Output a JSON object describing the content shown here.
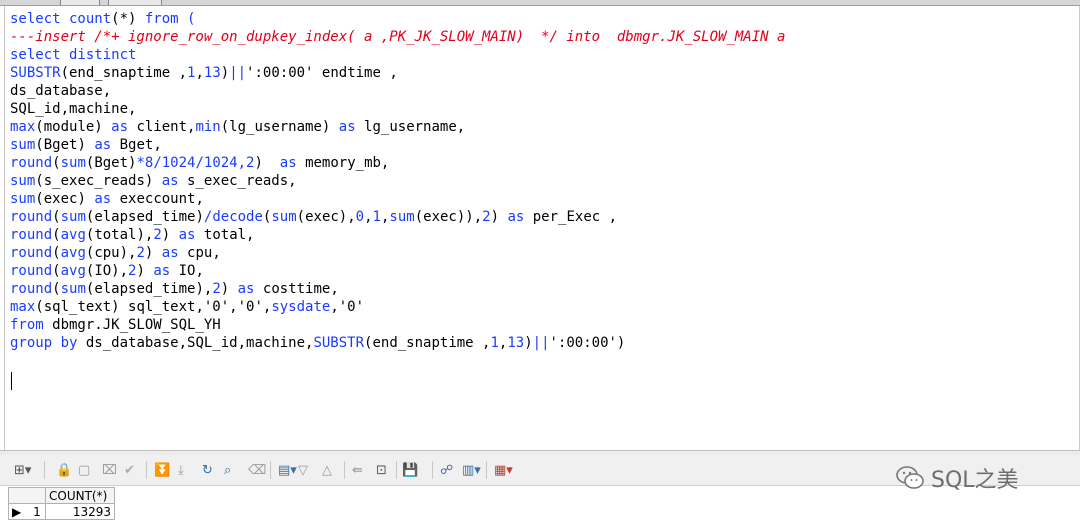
{
  "editor": {
    "lines": [
      [
        {
          "t": "select count",
          "c": "kw"
        },
        {
          "t": "(*)",
          "c": ""
        },
        {
          "t": " from (",
          "c": "kw"
        }
      ],
      [
        {
          "t": "---insert /*+ ignore_row_on_dupkey_index( a ,PK_JK_SLOW_MAIN)  */ into  dbmgr.JK_SLOW_MAIN a",
          "c": "cm"
        }
      ],
      [
        {
          "t": "select distinct",
          "c": "kw"
        }
      ],
      [
        {
          "t": "SUBSTR",
          "c": "kw"
        },
        {
          "t": "(end_snaptime ,",
          "c": ""
        },
        {
          "t": "1",
          "c": "kw"
        },
        {
          "t": ",",
          "c": ""
        },
        {
          "t": "13",
          "c": "kw"
        },
        {
          "t": ")",
          "c": ""
        },
        {
          "t": "||",
          "c": "kw"
        },
        {
          "t": "':00:00' endtime ,",
          "c": ""
        }
      ],
      [
        {
          "t": "ds_database,",
          "c": ""
        }
      ],
      [
        {
          "t": "SQL_id,machine,",
          "c": ""
        }
      ],
      [
        {
          "t": "max",
          "c": "kw"
        },
        {
          "t": "(module) ",
          "c": ""
        },
        {
          "t": "as",
          "c": "kw"
        },
        {
          "t": " client,",
          "c": ""
        },
        {
          "t": "min",
          "c": "kw"
        },
        {
          "t": "(lg_username) ",
          "c": ""
        },
        {
          "t": "as",
          "c": "kw"
        },
        {
          "t": " lg_username,",
          "c": ""
        }
      ],
      [
        {
          "t": "sum",
          "c": "kw"
        },
        {
          "t": "(Bget) ",
          "c": ""
        },
        {
          "t": "as",
          "c": "kw"
        },
        {
          "t": " Bget,",
          "c": ""
        }
      ],
      [
        {
          "t": "round",
          "c": "kw"
        },
        {
          "t": "(",
          "c": ""
        },
        {
          "t": "sum",
          "c": "kw"
        },
        {
          "t": "(Bget)",
          "c": ""
        },
        {
          "t": "*8/1024/1024,2",
          "c": "kw"
        },
        {
          "t": ")  ",
          "c": ""
        },
        {
          "t": "as",
          "c": "kw"
        },
        {
          "t": " memory_mb,",
          "c": ""
        }
      ],
      [
        {
          "t": "sum",
          "c": "kw"
        },
        {
          "t": "(s_exec_reads) ",
          "c": ""
        },
        {
          "t": "as",
          "c": "kw"
        },
        {
          "t": " s_exec_reads,",
          "c": ""
        }
      ],
      [
        {
          "t": "sum",
          "c": "kw"
        },
        {
          "t": "(exec) ",
          "c": ""
        },
        {
          "t": "as",
          "c": "kw"
        },
        {
          "t": " execcount,",
          "c": ""
        }
      ],
      [
        {
          "t": "round",
          "c": "kw"
        },
        {
          "t": "(",
          "c": ""
        },
        {
          "t": "sum",
          "c": "kw"
        },
        {
          "t": "(elapsed_time)",
          "c": ""
        },
        {
          "t": "/decode",
          "c": "kw"
        },
        {
          "t": "(",
          "c": ""
        },
        {
          "t": "sum",
          "c": "kw"
        },
        {
          "t": "(exec),",
          "c": ""
        },
        {
          "t": "0",
          "c": "kw"
        },
        {
          "t": ",",
          "c": ""
        },
        {
          "t": "1",
          "c": "kw"
        },
        {
          "t": ",",
          "c": ""
        },
        {
          "t": "sum",
          "c": "kw"
        },
        {
          "t": "(exec)),",
          "c": ""
        },
        {
          "t": "2",
          "c": "kw"
        },
        {
          "t": ") ",
          "c": ""
        },
        {
          "t": "as",
          "c": "kw"
        },
        {
          "t": " per_Exec ,",
          "c": ""
        }
      ],
      [
        {
          "t": "round",
          "c": "kw"
        },
        {
          "t": "(",
          "c": ""
        },
        {
          "t": "avg",
          "c": "kw"
        },
        {
          "t": "(total),",
          "c": ""
        },
        {
          "t": "2",
          "c": "kw"
        },
        {
          "t": ") ",
          "c": ""
        },
        {
          "t": "as",
          "c": "kw"
        },
        {
          "t": " total,",
          "c": ""
        }
      ],
      [
        {
          "t": "round",
          "c": "kw"
        },
        {
          "t": "(",
          "c": ""
        },
        {
          "t": "avg",
          "c": "kw"
        },
        {
          "t": "(cpu),",
          "c": ""
        },
        {
          "t": "2",
          "c": "kw"
        },
        {
          "t": ") ",
          "c": ""
        },
        {
          "t": "as",
          "c": "kw"
        },
        {
          "t": " cpu,",
          "c": ""
        }
      ],
      [
        {
          "t": "round",
          "c": "kw"
        },
        {
          "t": "(",
          "c": ""
        },
        {
          "t": "avg",
          "c": "kw"
        },
        {
          "t": "(IO),",
          "c": ""
        },
        {
          "t": "2",
          "c": "kw"
        },
        {
          "t": ") ",
          "c": ""
        },
        {
          "t": "as",
          "c": "kw"
        },
        {
          "t": " IO,",
          "c": ""
        }
      ],
      [
        {
          "t": "round",
          "c": "kw"
        },
        {
          "t": "(",
          "c": ""
        },
        {
          "t": "sum",
          "c": "kw"
        },
        {
          "t": "(elapsed_time),",
          "c": ""
        },
        {
          "t": "2",
          "c": "kw"
        },
        {
          "t": ") ",
          "c": ""
        },
        {
          "t": "as",
          "c": "kw"
        },
        {
          "t": " costtime,",
          "c": ""
        }
      ],
      [
        {
          "t": "max",
          "c": "kw"
        },
        {
          "t": "(sql_text) sql_text,'0','0',",
          "c": ""
        },
        {
          "t": "sysdate",
          "c": "kw"
        },
        {
          "t": ",'0'",
          "c": ""
        }
      ],
      [
        {
          "t": "from",
          "c": "kw"
        },
        {
          "t": " dbmgr.JK_SLOW_SQL_YH",
          "c": ""
        }
      ],
      [
        {
          "t": "group by",
          "c": "kw"
        },
        {
          "t": " ds_database,SQL_id,machine,",
          "c": ""
        },
        {
          "t": "SUBSTR",
          "c": "kw"
        },
        {
          "t": "(end_snaptime ,",
          "c": ""
        },
        {
          "t": "1",
          "c": "kw"
        },
        {
          "t": ",",
          "c": ""
        },
        {
          "t": "13",
          "c": "kw"
        },
        {
          "t": ")",
          "c": ""
        },
        {
          "t": "||",
          "c": "kw"
        },
        {
          "t": "':00:00')",
          "c": ""
        }
      ]
    ]
  },
  "toolbar": {
    "buttons": [
      {
        "name": "grid-options-icon",
        "glyph": "⊞▾",
        "color": "#555",
        "interact": true
      },
      {
        "name": "lock-icon",
        "glyph": "🔒",
        "color": "#c0392b",
        "interact": true
      },
      {
        "name": "insert-record-icon",
        "glyph": "▢",
        "color": "#999",
        "interact": true
      },
      {
        "name": "delete-record-icon",
        "glyph": "⌧",
        "color": "#999",
        "interact": true
      },
      {
        "name": "post-changes-icon",
        "glyph": "✔",
        "color": "#aaa",
        "interact": true
      },
      {
        "name": "fetch-next-icon",
        "glyph": "⏬",
        "color": "#999",
        "interact": true
      },
      {
        "name": "fetch-all-icon",
        "glyph": "⤓",
        "color": "#999",
        "interact": true
      },
      {
        "name": "refresh-icon",
        "glyph": "↻",
        "color": "#3a6ea5",
        "interact": true
      },
      {
        "name": "find-icon",
        "glyph": "⌕",
        "color": "#3a6ea5",
        "interact": true
      },
      {
        "name": "clear-icon",
        "glyph": "⌫",
        "color": "#999",
        "interact": true
      },
      {
        "name": "single-record-view-icon",
        "glyph": "▤▾",
        "color": "#3a6ea5",
        "interact": true
      },
      {
        "name": "filter-icon",
        "glyph": "▽",
        "color": "#999",
        "interact": true
      },
      {
        "name": "sort-icon",
        "glyph": "△",
        "color": "#999",
        "interact": true
      },
      {
        "name": "query-by-example-icon",
        "glyph": "⇚",
        "color": "#999",
        "interact": true
      },
      {
        "name": "export-icon",
        "glyph": "⊡",
        "color": "#555",
        "interact": true
      },
      {
        "name": "save-icon",
        "glyph": "💾",
        "color": "#3a6ea5",
        "interact": true
      },
      {
        "name": "connect-icon",
        "glyph": "☍",
        "color": "#3a6ea5",
        "interact": true
      },
      {
        "name": "chart-icon",
        "glyph": "▥▾",
        "color": "#3a6ea5",
        "interact": true
      },
      {
        "name": "table-view-icon",
        "glyph": "▦▾",
        "color": "#c0392b",
        "interact": true
      }
    ]
  },
  "results": {
    "column": "COUNT(*)",
    "row_number": "1",
    "value": "13293"
  },
  "watermark": {
    "text": "SQL之美"
  }
}
